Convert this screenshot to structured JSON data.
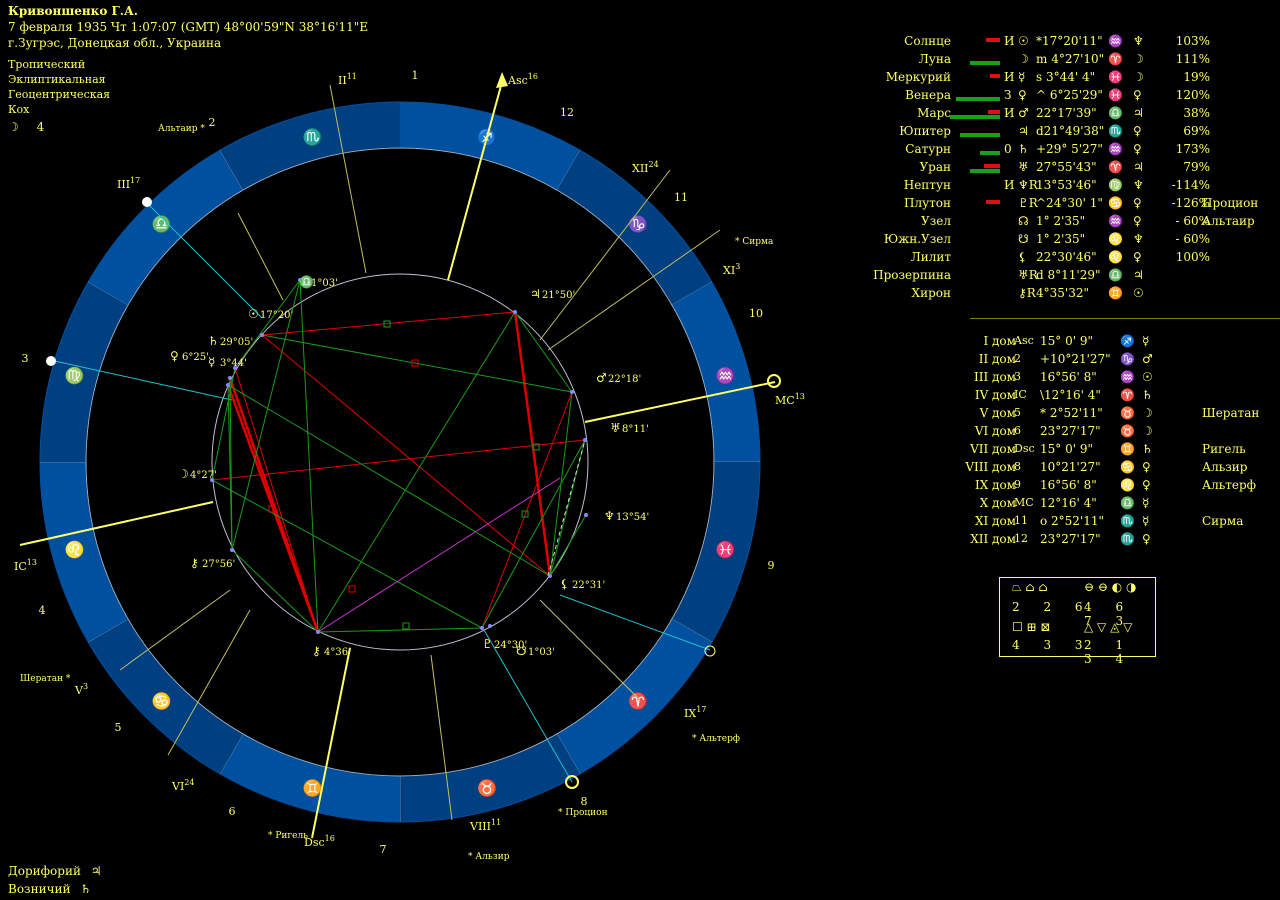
{
  "header": {
    "name": "Кривоншенко Г.А.",
    "datetime": "7 февраля 1935  Чт   1:07:07 (GMT)  48°00'59\"N  38°16'11\"E",
    "place": "г.Зугрэс, Донецкая обл., Украина",
    "zodiac": "Тропический",
    "coords": "Эклиптикальная",
    "center": "Геоцентрическая",
    "houses": "Кох",
    "moon_phase_symbol": "☽",
    "moon_phase_value": "4"
  },
  "planets": [
    {
      "name": "Солнце",
      "flag": "И",
      "symbol": "☉",
      "pos": "*17°20'11\"",
      "sign": "♒",
      "ruler": "♆",
      "pct": "103%",
      "bar_red": 14,
      "bar_green": 0
    },
    {
      "name": "Луна",
      "flag": "",
      "symbol": "☽",
      "pos": "m 4°27'10\"",
      "sign": "♈",
      "ruler": "☽",
      "pct": "111%",
      "bar_red": 0,
      "bar_green": 30
    },
    {
      "name": "Меркурий",
      "flag": "И",
      "symbol": "☿",
      "pos": "s 3°44' 4\"",
      "sign": "♓",
      "ruler": "☽",
      "pct": "19%",
      "bar_red": 10,
      "bar_green": 0
    },
    {
      "name": "Венера",
      "flag": "З",
      "symbol": "♀",
      "pos": "^ 6°25'29\"",
      "sign": "♓",
      "ruler": "♀",
      "pct": "120%",
      "bar_red": 0,
      "bar_green": 44
    },
    {
      "name": "Марс",
      "flag": "И",
      "symbol": "♂",
      "pos": "22°17'39\"",
      "sign": "♎",
      "ruler": "♃",
      "pct": "38%",
      "bar_red": 12,
      "bar_green": 50
    },
    {
      "name": "Юпитер",
      "flag": "",
      "symbol": "♃",
      "pos": "d21°49'38\"",
      "sign": "♏",
      "ruler": "♀",
      "pct": "69%",
      "bar_red": 0,
      "bar_green": 40
    },
    {
      "name": "Сатурн",
      "flag": "0",
      "symbol": "♄",
      "pos": "+29° 5'27\"",
      "sign": "♒",
      "ruler": "♀",
      "pct": "173%",
      "bar_red": 0,
      "bar_green": 20
    },
    {
      "name": "Уран",
      "flag": "",
      "symbol": "♅",
      "pos": "27°55'43\"",
      "sign": "♈",
      "ruler": "♃",
      "pct": "79%",
      "bar_red": 16,
      "bar_green": 30
    },
    {
      "name": "Нептун",
      "flag": "И",
      "symbol": "♆R",
      "pos": "13°53'46\"",
      "sign": "♍",
      "ruler": "♆",
      "pct": "-114%",
      "bar_red": 0,
      "bar_green": 0
    },
    {
      "name": "Плутон",
      "flag": "",
      "symbol": "♇R",
      "pos": "^24°30' 1\"",
      "sign": "♋",
      "ruler": "♀",
      "pct": "-126%",
      "bar_red": 14,
      "bar_green": 0,
      "star": "Процион"
    },
    {
      "name": "Узел",
      "flag": "",
      "symbol": "☊",
      "pos": "1° 2'35\"",
      "sign": "♒",
      "ruler": "♀",
      "pct": "- 60%",
      "bar_red": 0,
      "bar_green": 0,
      "star": "Альтаир"
    },
    {
      "name": "Южн.Узел",
      "flag": "",
      "symbol": "☋",
      "pos": "1° 2'35\"",
      "sign": "♌",
      "ruler": "♆",
      "pct": "- 60%",
      "bar_red": 0,
      "bar_green": 0
    },
    {
      "name": "Лилит",
      "flag": "",
      "symbol": "⚸",
      "pos": "22°30'46\"",
      "sign": "♌",
      "ruler": "♀",
      "pct": "100%",
      "bar_red": 0,
      "bar_green": 0
    },
    {
      "name": "Прозерпина",
      "flag": "",
      "symbol": "♅R",
      "pos": "d 8°11'29\"",
      "sign": "♎",
      "ruler": "♃",
      "pct": "",
      "bar_red": 0,
      "bar_green": 0
    },
    {
      "name": "Хирон",
      "flag": "",
      "symbol": "⚷R",
      "pos": "4°35'32\"",
      "sign": "♊",
      "ruler": "☉",
      "pct": "",
      "bar_red": 0,
      "bar_green": 0
    }
  ],
  "houses": [
    {
      "name": "I дом",
      "cusp": "Asc",
      "pos": "15° 0' 9\"",
      "sign": "♐",
      "ruler": "☿",
      "star": ""
    },
    {
      "name": "II дом",
      "cusp": "2",
      "pos": "+10°21'27\"",
      "sign": "♑",
      "ruler": "♂",
      "star": ""
    },
    {
      "name": "III дом",
      "cusp": "3",
      "pos": "16°56' 8\"",
      "sign": "♒",
      "ruler": "☉",
      "star": ""
    },
    {
      "name": "IV дом",
      "cusp": "IC",
      "pos": "\\12°16' 4\"",
      "sign": "♈",
      "ruler": "♄",
      "star": ""
    },
    {
      "name": "V дом",
      "cusp": "5",
      "pos": "* 2°52'11\"",
      "sign": "♉",
      "ruler": "☽",
      "star": "Шератан"
    },
    {
      "name": "VI дом",
      "cusp": "6",
      "pos": "23°27'17\"",
      "sign": "♉",
      "ruler": "☽",
      "star": ""
    },
    {
      "name": "VII дом",
      "cusp": "Dsc",
      "pos": "15° 0' 9\"",
      "sign": "♊",
      "ruler": "♄",
      "star": "Ригель"
    },
    {
      "name": "VIII дом",
      "cusp": "8",
      "pos": "10°21'27\"",
      "sign": "♋",
      "ruler": "♀",
      "star": "Альзир"
    },
    {
      "name": "IX дом",
      "cusp": "9",
      "pos": "16°56' 8\"",
      "sign": "♌",
      "ruler": "♀",
      "star": "Альтерф"
    },
    {
      "name": "X дом",
      "cusp": "MC",
      "pos": "12°16' 4\"",
      "sign": "♎",
      "ruler": "☿",
      "star": ""
    },
    {
      "name": "XI дом",
      "cusp": "11",
      "pos": "o 2°52'11\"",
      "sign": "♏",
      "ruler": "☿",
      "star": "Сирма"
    },
    {
      "name": "XII дом",
      "cusp": "12",
      "pos": "23°27'17\"",
      "sign": "♏",
      "ruler": "♀",
      "star": ""
    }
  ],
  "legend": {
    "row1_vals": [
      "2",
      "2",
      "6"
    ],
    "row1b_vals": [
      "4",
      "6",
      "7",
      "3"
    ],
    "row2_vals": [
      "4",
      "3",
      "3"
    ],
    "row2b_vals": [
      "2",
      "1",
      "3",
      "4"
    ]
  },
  "footer": {
    "line1_label": "Дорифорий",
    "line1_symbol": "♃",
    "line2_label": "Возничий",
    "line2_symbol": "♄"
  },
  "wheel": {
    "signs": [
      "♐",
      "♑",
      "♒",
      "♓",
      "♈",
      "♉",
      "♊",
      "♋",
      "♌",
      "♍",
      "♎",
      "♏"
    ],
    "house_numbers": [
      "1",
      "2",
      "3",
      "4",
      "5",
      "6",
      "7",
      "8",
      "9",
      "10",
      "11",
      "12"
    ],
    "cusp_labels": {
      "asc": "Asc",
      "asc_deg": "16",
      "mc": "MC",
      "mc_deg": "13",
      "ic": "IC",
      "ic_deg": "13",
      "dsc": "Dsc",
      "dsc_deg": "16",
      "h2": "II",
      "h2_deg": "11",
      "h3": "III",
      "h3_deg": "17",
      "h5": "V",
      "h5_deg": "3",
      "h6": "VI",
      "h6_deg": "24",
      "h8": "VIII",
      "h8_deg": "11",
      "h9": "IX",
      "h9_deg": "17",
      "h11": "XI",
      "h11_deg": "3",
      "h12": "XII",
      "h12_deg": "24"
    },
    "stars": [
      "Альтаир",
      "Сирма",
      "Шератан",
      "Альтерф",
      "Процион",
      "Ригель",
      "Альзир"
    ],
    "planet_labels": {
      "node": "1°03'",
      "jupiter": "21°50'",
      "sun": "17°20'",
      "saturn": "29°05'",
      "venus": "6°25'",
      "mercury": "3°44'",
      "mars": "22°18'",
      "uranus": "8°11'",
      "moon": "4°27'",
      "neptune": "13°54'",
      "chiron_r": "27°56'",
      "lilith": "22°31'",
      "chiron": "4°36'",
      "pluto": "24°30'",
      "snode": "1°03'"
    }
  },
  "colors": {
    "accent": "#ffff66",
    "ring": "#0050a0",
    "ring_dark": "#003f80",
    "aspect_red": "#dd0000",
    "aspect_green": "#1a9a1a",
    "aspect_magenta": "#cc33cc",
    "cyan": "#22c0d0"
  }
}
